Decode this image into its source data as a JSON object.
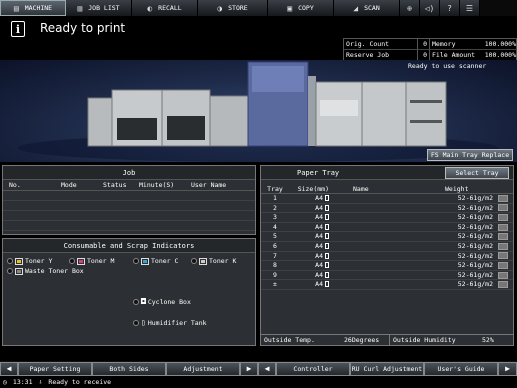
{
  "tabs": [
    {
      "label": "MACHINE",
      "icon": "machine-icon",
      "active": true
    },
    {
      "label": "JOB LIST",
      "icon": "list-icon",
      "active": false
    },
    {
      "label": "RECALL",
      "icon": "recall-icon",
      "active": false
    },
    {
      "label": "STORE",
      "icon": "store-icon",
      "active": false
    },
    {
      "label": "COPY",
      "icon": "copy-icon",
      "active": false
    },
    {
      "label": "SCAN",
      "icon": "scan-icon",
      "active": false
    }
  ],
  "status": {
    "message": "Ready to print",
    "scanner": "Ready to use scanner"
  },
  "counters": {
    "orig_count_label": "Orig. Count",
    "orig_count": "0",
    "memory_label": "Memory",
    "memory": "100.000%",
    "reserve_job_label": "Reserve Job",
    "reserve_job": "0",
    "file_amount_label": "File Amount",
    "file_amount": "100.000%"
  },
  "fs_button": "FS Main Tray Replace",
  "job": {
    "title": "Job",
    "columns": [
      "No.",
      "Mode",
      "Status",
      "Minute(S)",
      "User Name"
    ]
  },
  "consumables": {
    "title": "Consumable and Scrap Indicators",
    "toner_y": "Toner Y",
    "toner_m": "Toner M",
    "toner_c": "Toner C",
    "toner_k": "Toner K",
    "waste": "Waste Toner Box",
    "cyclone": "Cyclone Box",
    "humidifier": "Humidifier Tank",
    "colors": {
      "y": "#e8c21a",
      "m": "#d23c8c",
      "c": "#2aa6d8",
      "k": "#cccccc"
    }
  },
  "paper_tray": {
    "title": "Paper Tray",
    "select_label": "Select Tray",
    "columns": [
      "Tray",
      "Size(mm)",
      "Name",
      "Weight"
    ],
    "rows": [
      {
        "tray": "1",
        "size": "A4",
        "name": "",
        "weight": "52-61g/m2"
      },
      {
        "tray": "2",
        "size": "A4",
        "name": "",
        "weight": "52-61g/m2"
      },
      {
        "tray": "3",
        "size": "A4",
        "name": "",
        "weight": "52-61g/m2"
      },
      {
        "tray": "4",
        "size": "A4",
        "name": "",
        "weight": "52-61g/m2"
      },
      {
        "tray": "5",
        "size": "A4",
        "name": "",
        "weight": "52-61g/m2"
      },
      {
        "tray": "6",
        "size": "A4",
        "name": "",
        "weight": "52-61g/m2"
      },
      {
        "tray": "7",
        "size": "A4",
        "name": "",
        "weight": "52-61g/m2"
      },
      {
        "tray": "8",
        "size": "A4",
        "name": "",
        "weight": "52-61g/m2"
      },
      {
        "tray": "9",
        "size": "A4",
        "name": "",
        "weight": "52-61g/m2"
      },
      {
        "tray": "±",
        "size": "A4",
        "name": "",
        "weight": "52-61g/m2"
      }
    ],
    "outside_temp_label": "Outside Temp.",
    "outside_temp": "26Degrees",
    "outside_humidity_label": "Outside Humidity",
    "outside_humidity": "52%"
  },
  "bottom": {
    "paper_setting": "Paper Setting",
    "both_sides": "Both Sides",
    "adjustment": "Adjustment",
    "controller": "Controller",
    "ru_curl": "RU Curl Adjustment",
    "users_guide": "User's Guide"
  },
  "footer": {
    "time": "13:31",
    "status": "Ready to receive"
  }
}
